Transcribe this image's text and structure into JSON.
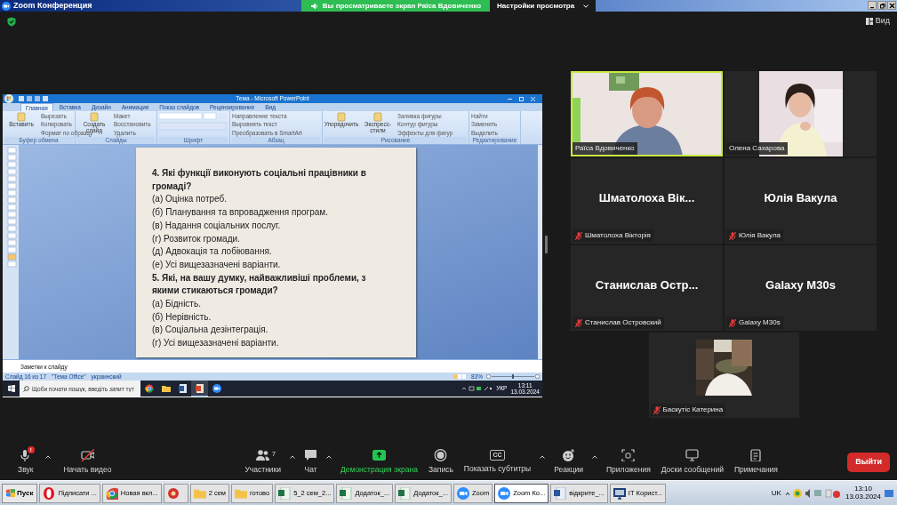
{
  "window": {
    "title": "Zoom Конференция"
  },
  "share_banner": {
    "text": "Вы просматриваете экран Раїса Вдовиченко",
    "settings": "Настройки просмотра"
  },
  "view_button": "Вид",
  "shared_screen": {
    "app_title": "Тема - Microsoft PowerPoint",
    "ribbon_tabs": [
      {
        "label": "Главная",
        "selected": true
      },
      {
        "label": "Вставка",
        "selected": false
      },
      {
        "label": "Дизайн",
        "selected": false
      },
      {
        "label": "Анимация",
        "selected": false
      },
      {
        "label": "Показ слайдов",
        "selected": false
      },
      {
        "label": "Рецензирование",
        "selected": false
      },
      {
        "label": "Вид",
        "selected": false
      }
    ],
    "ribbon_groups": [
      {
        "label": "Буфер обмена",
        "large": [
          "Вставить"
        ],
        "small": [
          "Вырезать",
          "Копировать",
          "Формат по образцу"
        ]
      },
      {
        "label": "Слайды",
        "large": [
          "Создать слайд"
        ],
        "small": [
          "Макет",
          "Восстановить",
          "Удалить"
        ]
      },
      {
        "label": "Шрифт"
      },
      {
        "label": "Абзац",
        "small": [
          "Направление текста",
          "Выровнять текст",
          "Преобразовать в SmartArt"
        ]
      },
      {
        "label": "Рисование",
        "large": [
          "Упорядочить",
          "Экспресс-стили"
        ],
        "small": [
          "Заливка фигуры",
          "Контур фигуры",
          "Эффекты для фигур"
        ]
      },
      {
        "label": "Редактирование",
        "small": [
          "Найти",
          "Заменить",
          "Выделить"
        ]
      }
    ],
    "slide": {
      "lines": [
        {
          "kind": "question",
          "text": "4. Які функції виконують соціальні працівники в громаді?"
        },
        {
          "kind": "option",
          "text": "(а) Оцінка потреб."
        },
        {
          "kind": "option",
          "text": "(б) Планування та впровадження програм."
        },
        {
          "kind": "option",
          "text": "(в) Надання соціальних послуг."
        },
        {
          "kind": "option",
          "text": "(г) Розвиток громади."
        },
        {
          "kind": "option",
          "text": "(д) Адвокація та лобіювання."
        },
        {
          "kind": "option",
          "text": "(е) Усі вищезазначені варіанти."
        },
        {
          "kind": "question",
          "text": "5. Які, на вашу думку, найважливіші проблеми, з якими стикаються громади?"
        },
        {
          "kind": "option",
          "text": "(а) Бідність."
        },
        {
          "kind": "option",
          "text": "(б) Нерівність."
        },
        {
          "kind": "option",
          "text": "(в) Соціальна дезінтеграція."
        },
        {
          "kind": "option",
          "text": "(г) Усі вищезазначені варіанти."
        }
      ]
    },
    "notes_placeholder": "Заметки к слайду",
    "status": [
      "Слайд 16 из 17",
      "\"Тема Office\"",
      "украинский"
    ],
    "zoom_level": "83%",
    "taskbar": {
      "search_placeholder": "Щоби почати пошук, введіть запит тут",
      "apps": [
        {
          "kind": "browser",
          "active": false
        },
        {
          "kind": "folder",
          "active": false
        },
        {
          "kind": "document",
          "active": false
        },
        {
          "kind": "presentation",
          "active": true
        },
        {
          "kind": "video-app",
          "active": false
        }
      ],
      "language": "УКР",
      "time": "13:11",
      "date": "13.03.2024"
    }
  },
  "participants": [
    {
      "kind": "video",
      "name": "Раїса Вдовиченко",
      "speaking": true,
      "muted": false
    },
    {
      "name": "Олена Сахарова",
      "speaking": false,
      "muted": false
    },
    {
      "kind": "name",
      "display": "Шматолоха  Вік...",
      "name": "Шматолоха Вікторія",
      "speaking": false,
      "muted": true
    },
    {
      "kind": "name",
      "display": "Юлія Вакула",
      "name": "Юлія Вакула",
      "speaking": false,
      "muted": true
    },
    {
      "kind": "name",
      "display": "Станислав  Остр...",
      "name": "Станислав Островский",
      "speaking": false,
      "muted": true
    },
    {
      "kind": "name",
      "display": "Galaxy M30s",
      "name": "Galaxy M30s",
      "speaking": false,
      "muted": true
    },
    {
      "name": "Баскутіс Катерина",
      "speaking": false,
      "muted": true
    }
  ],
  "toolbar": [
    {
      "kind": "audio",
      "label": "Звук",
      "badge": "!",
      "caret": true
    },
    {
      "kind": "video",
      "label": "Начать видео",
      "caret": false
    },
    {
      "kind": "participants",
      "label": "Участники",
      "count": "7",
      "caret": true
    },
    {
      "kind": "chat",
      "label": "Чат",
      "caret": true
    },
    {
      "kind": "share",
      "label": "Демонстрация экрана",
      "caret": false
    },
    {
      "kind": "record",
      "label": "Запись",
      "caret": false
    },
    {
      "kind": "captions",
      "label": "Показать субтитры",
      "icon_text": "CC",
      "caret": true
    },
    {
      "kind": "reactions",
      "label": "Реакции",
      "caret": true
    },
    {
      "kind": "apps",
      "label": "Приложения",
      "caret": false
    },
    {
      "kind": "whiteboards",
      "label": "Доски сообщений",
      "caret": false
    },
    {
      "kind": "notes",
      "label": "Примечания",
      "caret": false
    }
  ],
  "leave_button": "Выйти",
  "taskbar": {
    "start": "Пуск",
    "tasks": [
      {
        "kind": "browser-red",
        "label": "Підписати ...",
        "active": false
      },
      {
        "kind": "browser",
        "label": "Новая вкл...",
        "active": false
      },
      {
        "kind": "app",
        "active": false
      },
      {
        "kind": "folder",
        "label": "2 сем",
        "active": false
      },
      {
        "kind": "folder",
        "label": "готово",
        "active": false
      },
      {
        "kind": "spreadsheet",
        "label": "5_2 сем_2...",
        "active": false
      },
      {
        "kind": "spreadsheet",
        "label": "Додаток_...",
        "active": false
      },
      {
        "kind": "spreadsheet",
        "label": "Додаток_...",
        "active": false
      },
      {
        "kind": "video-app",
        "label": "Zoom",
        "active": false
      },
      {
        "kind": "video-app",
        "label": "Zoom Ко...",
        "active": true
      },
      {
        "kind": "document",
        "label": "відкрите_...",
        "active": false
      },
      {
        "kind": "monitor",
        "label": "ІТ Корист...",
        "active": false
      }
    ],
    "language": "UK",
    "time": "13:10",
    "date": "13.03.2024"
  }
}
